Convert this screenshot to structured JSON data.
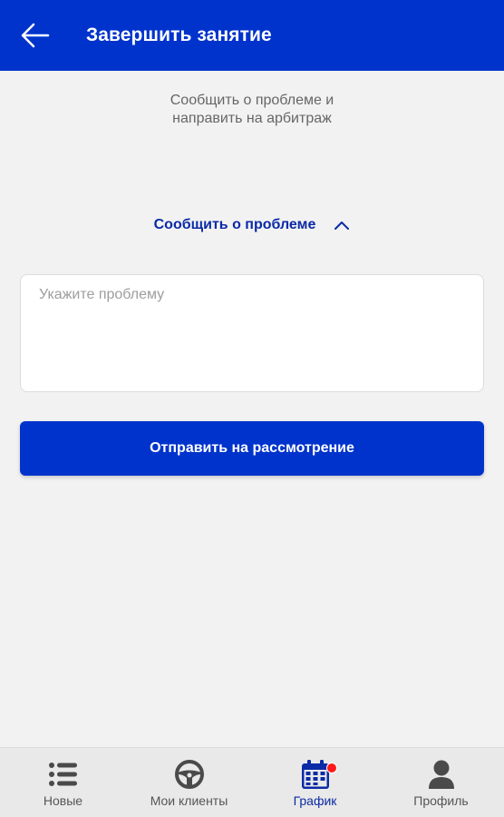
{
  "header": {
    "title": "Завершить занятие",
    "back_icon": "arrow-left-icon"
  },
  "main": {
    "subtitle_line1": "Сообщить о проблеме и",
    "subtitle_line2": "направить на арбитраж",
    "report_toggle_label": "Сообщить о проблеме",
    "report_toggle_icon": "chevron-up-icon",
    "problem_input": {
      "placeholder": "Укажите проблему",
      "value": ""
    },
    "submit_label": "Отправить на рассмотрение"
  },
  "bottom_nav": {
    "items": [
      {
        "label": "Новые",
        "icon": "list-icon",
        "active": false
      },
      {
        "label": "Мои клиенты",
        "icon": "steering-wheel-icon",
        "active": false
      },
      {
        "label": "График",
        "icon": "calendar-icon",
        "active": true,
        "badge": true
      },
      {
        "label": "Профиль",
        "icon": "person-icon",
        "active": false
      }
    ]
  },
  "colors": {
    "primary": "#0033cc",
    "accent_text": "#0a2aa6",
    "badge": "#ff1a1a",
    "background": "#f2f2f2",
    "nav_background": "#e9e9e9",
    "inactive_icon": "#4a4a4a"
  }
}
